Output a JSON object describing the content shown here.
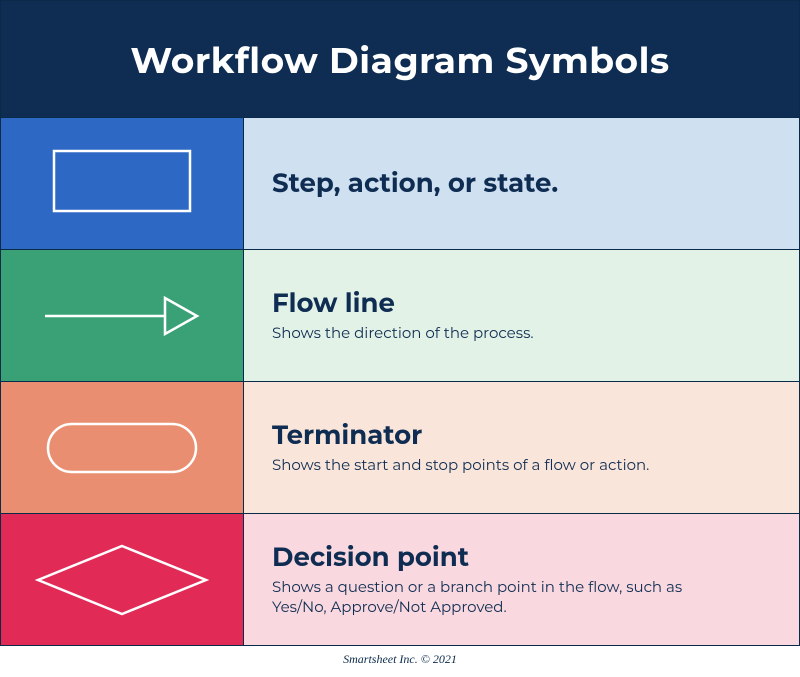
{
  "header": {
    "title": "Workflow Diagram Symbols"
  },
  "rows": [
    {
      "title": "Step, action, or state.",
      "desc": ""
    },
    {
      "title": "Flow line",
      "desc": "Shows the direction of the process."
    },
    {
      "title": "Terminator",
      "desc": "Shows the start and stop points of a flow or action."
    },
    {
      "title": "Decision point",
      "desc": "Shows a question or a branch point in the flow, such as Yes/No, Approve/Not Approved."
    }
  ],
  "footer": {
    "credit": "Smartsheet Inc. © 2021"
  }
}
